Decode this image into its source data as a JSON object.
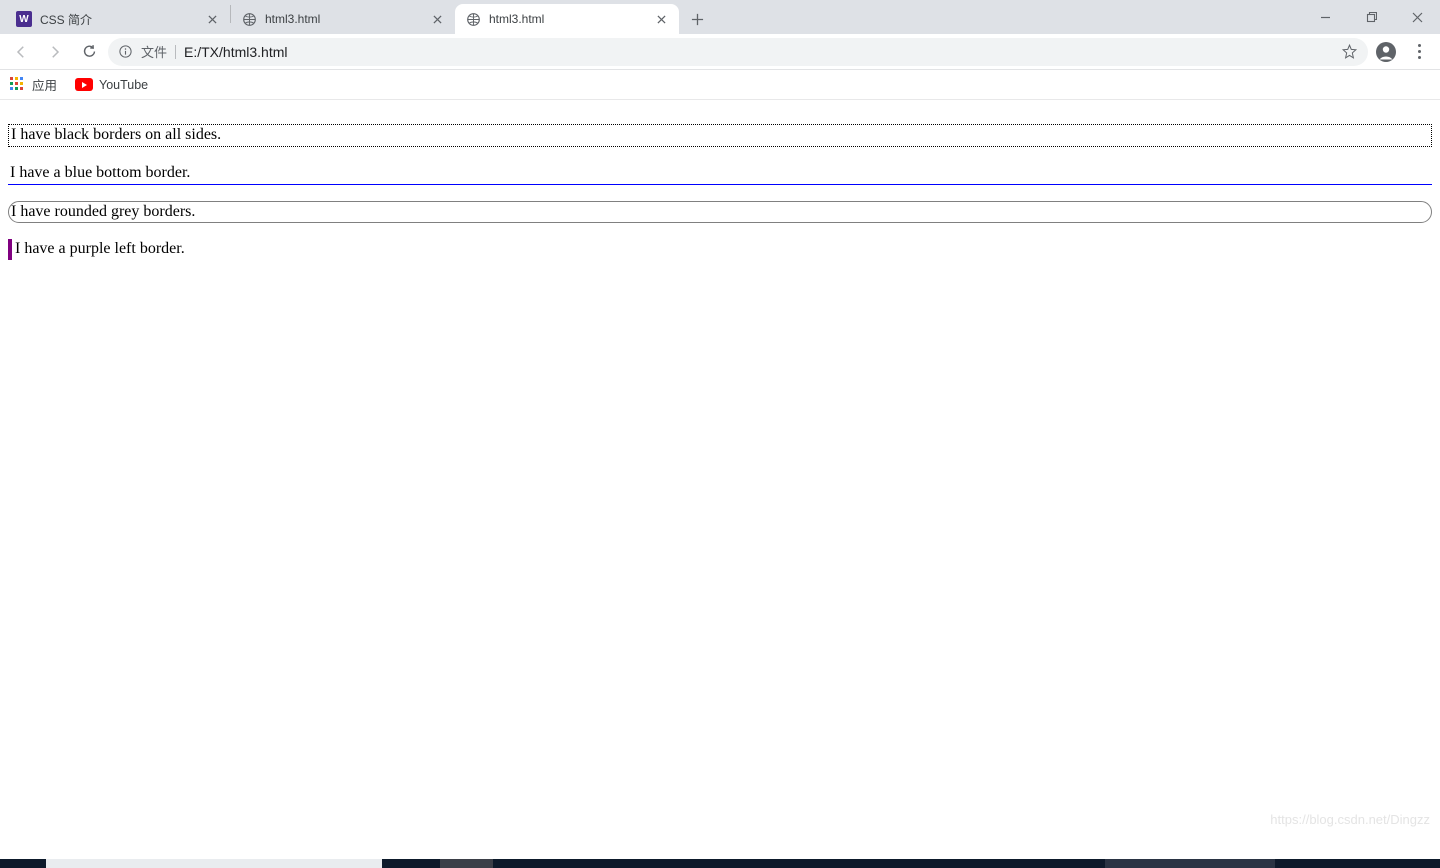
{
  "tabs": [
    {
      "title": "CSS 简介",
      "favicon": "w3"
    },
    {
      "title": "html3.html",
      "favicon": "globe"
    },
    {
      "title": "html3.html",
      "favicon": "globe"
    }
  ],
  "toolbar": {
    "url_prefix": "文件",
    "url": "E:/TX/html3.html"
  },
  "bookmarks": {
    "apps_label": "应用",
    "youtube_label": "YouTube"
  },
  "page": {
    "p1": "I have black borders on all sides.",
    "p2": "I have a blue bottom border.",
    "p3": "I have rounded grey borders.",
    "p4": "I have a purple left border."
  },
  "watermark": "https://blog.csdn.net/Dingzz"
}
